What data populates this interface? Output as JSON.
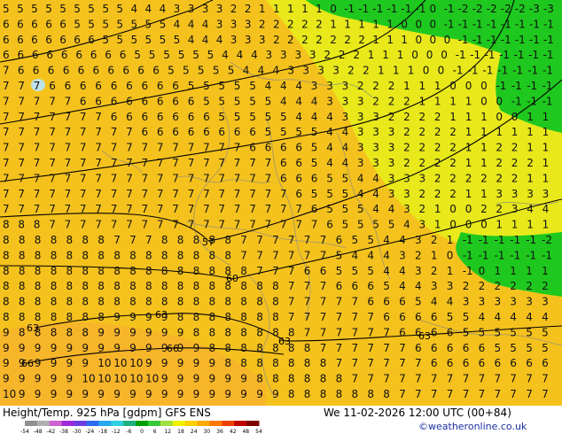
{
  "title": "Height/Temp. 925 hPa [gdpm] GFS ENS",
  "datetime": "We 11-02-2026 12:00 UTC (00+84)",
  "credit": "©weatheronline.co.uk",
  "colorbar": {
    "ticks": [
      "-54",
      "-48",
      "-42",
      "-38",
      "-30",
      "-24",
      "-18",
      "-12",
      "-6",
      "0",
      "6",
      "12",
      "18",
      "24",
      "30",
      "36",
      "42",
      "48",
      "54"
    ],
    "colors": [
      "#909090",
      "#b0b0b0",
      "#d060d0",
      "#9e2bd8",
      "#6a3fe0",
      "#2d6cf0",
      "#28a8f0",
      "#30d0e0",
      "#20b080",
      "#00a000",
      "#38c838",
      "#a0e040",
      "#f0f000",
      "#ffd000",
      "#ffa800",
      "#ff7800",
      "#f04000",
      "#c00000",
      "#800000"
    ]
  },
  "map": {
    "colors": {
      "fill_warm": "#f5c21d",
      "fill_warmer": "#f7b529",
      "fill_cool": "#e8e81a",
      "fill_green": "#1ec81e",
      "sea": "#bfe3e8"
    },
    "height_labels": [
      "57",
      "60",
      "63",
      "63",
      "63",
      "63",
      "66",
      "66"
    ],
    "value_rows": [
      "5 5 5 5 5 5 5 5 5 4 4 4 3 3 3 3 2 2 1 1 1 1 1 0 -1 -1 -1 -1 -1 -1 0 -1 -2 -2 -2 -2 -2 -3 -3",
      "6 6 6 6 6 5 5 5 5 5 5 5 4 4 4 3 3 3 2 2 2 2 2 1 1 1 1 1 0 0 0 -1 -1 -1 -1 -1 -1 -1 -1",
      "6 6 6 6 6 6 6 5 5 5 5 5 5 4 4 4 3 3 3 2 2 2 2 2 2 2 1 1 1 0 0 0 -1 -1 -1 -1 -1 -1 -1",
      "6 6 6 6 6 6 6 6 6 5 5 5 5 5 5 4 4 4 3 3 3 3 2 2 2 1 1 1 0 0 0 -1 -1 -1 -1 -1 -1 -1",
      "7 6 6 6 6 6 6 6 6 6 6 5 5 5 5 5 4 4 4 3 3 3 3 2 2 1 1 1 0 0 -1 -1 -1 -1 -1 -1 -1",
      "7 7 7 6 6 6 6 6 6 6 6 6 5 5 5 5 5 4 4 4 3 3 3 2 2 2 1 1 1 0 0 0 -1 -1 -1 -1",
      "7 7 7 7 7 6 6 6 6 6 6 6 6 5 5 5 5 5 4 4 4 3 3 3 2 2 2 1 1 1 1 0 0 -1 -1 -1",
      "7 7 7 7 7 7 7 6 6 6 6 6 6 6 5 5 5 5 5 4 4 4 3 3 3 2 2 2 2 1 1 1 0 0 1 1",
      "7 7 7 7 7 7 7 7 7 6 6 6 6 6 6 6 6 5 5 5 5 4 4 3 3 3 2 2 2 2 1 1 1 1 1 1",
      "7 7 7 7 7 7 7 7 7 7 7 7 7 7 7 7 6 6 6 6 5 4 4 3 3 3 2 2 2 2 1 1 2 2 1 1",
      "7 7 7 7 7 7 7 7 7 7 7 7 7 7 7 7 7 7 6 6 5 4 4 3 3 3 2 2 2 2 1 1 2 2 2 1",
      "7 7 7 7 7 7 7 7 7 7 7 7 7 7 7 7 7 7 6 6 6 5 5 4 4 3 3 3 2 2 2 2 2 2 1 1",
      "7 7 7 7 7 7 7 7 7 7 7 7 7 7 7 7 7 7 7 6 5 5 5 4 4 3 3 2 2 2 1 1 3 3 3 3",
      "7 7 7 7 7 7 7 7 7 7 7 7 7 7 7 7 7 7 7 7 6 5 5 5 4 4 3 2 1 0 0 2 2 3 4 4",
      "8 8 8 7 7 7 7 7 7 7 7 7 7 7 7 7 7 7 7 7 7 6 5 5 5 5 4 3 1 0 0 0 1 1 1 1",
      "8 8 8 8 8 8 8 7 7 7 8 8 8 8 8 7 7 7 7 7 7 6 5 5 4 4 3 2 1 -1 -1 -1 -1 -1 -2",
      "8 8 8 8 8 8 8 8 8 8 8 8 8 8 8 7 7 7 7 7 7 5 4 4 4 3 2 1 0 -1 -1 -1 -1 -1 -1",
      "8 8 8 8 8 8 8 8 8 8 8 8 8 8 8 8 7 7 7 6 6 5 5 5 4 4 3 2 1 -1 0 1 1 1 1",
      "8 8 8 8 8 8 8 8 8 8 8 8 8 8 8 8 8 8 7 7 7 6 6 6 5 4 4 3 3 2 2 2 2 2 2",
      "8 8 8 8 8 8 8 8 8 8 8 8 8 8 8 8 8 8 7 7 7 7 7 6 6 6 5 4 4 3 3 3 3 3 3",
      "8 8 8 8 8 8 8 9 9 9 9 8 8 8 8 8 8 8 7 7 7 7 7 7 6 6 6 6 5 5 4 4 4 4 4",
      "9 8 8 8 8 8 9 9 9 9 9 9 8 8 8 8 8 8 8 7 7 7 7 7 7 6 6 6 6 5 5 5 5 5 5",
      "9 9 9 9 9 9 9 9 9 9 9 9 9 8 8 8 8 8 8 8 7 7 7 7 7 7 6 6 6 6 6 5 5 5 5",
      "9 9 9 9 9 9 10 10 10 9 9 9 9 9 8 8 8 8 8 8 8 7 7 7 7 7 7 6 6 6 6 6 6 6 6",
      "9 9 9 9 9 10 10 10 10 10 9 9 9 9 9 9 8 8 8 8 8 8 7 7 7 7 7 7 7 7 7 7 7 7 7",
      "10 9 9 9 9 9 9 9 9 9 9 9 9 9 9 9 9 9 8 8 8 8 8 8 8 7 7 7 7 7 7 7 7 7 7"
    ]
  }
}
